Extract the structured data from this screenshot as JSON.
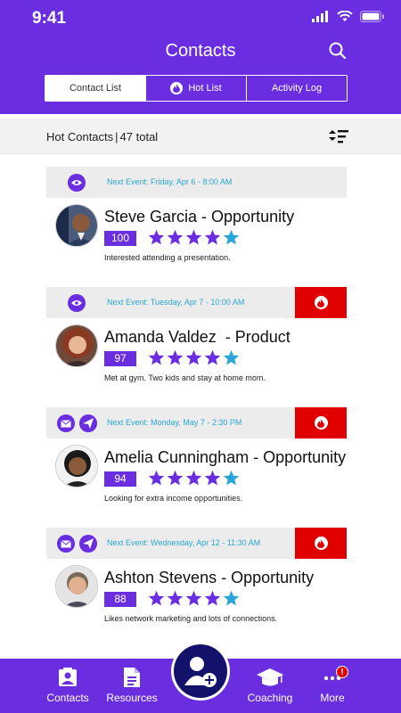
{
  "status": {
    "time": "9:41"
  },
  "header": {
    "title": "Contacts"
  },
  "tabs": [
    {
      "label": "Contact List",
      "active": true
    },
    {
      "label": "Hot List",
      "active": false,
      "icon": "flame-icon"
    },
    {
      "label": "Activity Log",
      "active": false
    }
  ],
  "summary": {
    "label": "Hot Contacts",
    "count": "47 total"
  },
  "contacts": [
    {
      "name": "Steve Garcia",
      "type": " - Opportunity",
      "next_event": "Next Event: Friday, Apr 6 - 8:00 AM",
      "score": "100",
      "stars": 5,
      "note": "Interested attending a presentation.",
      "hot": false,
      "actions": [
        "eye-icon"
      ]
    },
    {
      "name": "Amanda Valdez",
      "type": "  - Product",
      "next_event": "Next Event: Tuesday, Apr 7 - 10:00 AM",
      "score": "97",
      "stars": 5,
      "note": "Met at gym. Two kids and stay at home mom.",
      "hot": true,
      "actions": [
        "eye-icon"
      ]
    },
    {
      "name": "Amelia Cunningham",
      "type": " - Opportunity",
      "next_event": "Next Event: Monday, May 7 - 2:30 PM",
      "score": "94",
      "stars": 5,
      "note": "Looking for extra income opportunities.",
      "hot": true,
      "actions": [
        "mail-icon",
        "send-icon"
      ]
    },
    {
      "name": "Ashton Stevens",
      "type": " - Opportunity",
      "next_event": "Next Event: Wednesday, Apr 12 - 11:30 AM",
      "score": "88",
      "stars": 5,
      "note": "Likes network marketing and lots of connections.",
      "hot": true,
      "actions": [
        "mail-icon",
        "send-icon"
      ]
    }
  ],
  "tabbar": {
    "items": [
      {
        "label": "Contacts",
        "icon": "contacts-icon"
      },
      {
        "label": "Resources",
        "icon": "document-icon"
      },
      {
        "label": "Coaching",
        "icon": "graduation-cap-icon"
      },
      {
        "label": "More",
        "icon": "more-icon",
        "badge": "!"
      }
    ],
    "fab_icon": "add-contact-icon"
  },
  "colors": {
    "primary": "#6a2ee0",
    "hot": "#e00000",
    "event": "#29a6d6",
    "star_purple": "#6a2ee0",
    "star_blue": "#29a6d6",
    "fab": "#12126b"
  }
}
